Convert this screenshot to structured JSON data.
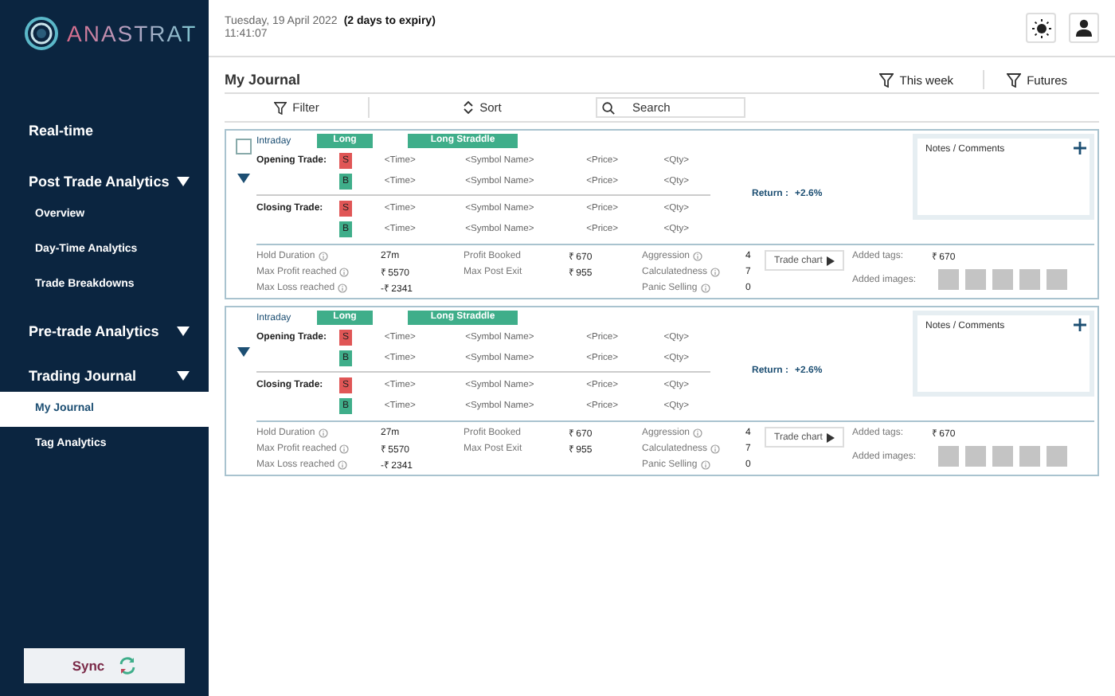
{
  "brand": {
    "name": "ANASTRAT"
  },
  "header": {
    "date": "Tuesday, 19 April 2022",
    "expiry": "(2 days to expiry)",
    "time": "11:41:07"
  },
  "sidebar": {
    "sections": [
      {
        "label": "Real-time",
        "dropdown": false
      },
      {
        "label": "Post Trade Analytics",
        "dropdown": true,
        "children": [
          {
            "label": "Overview",
            "selected": false
          },
          {
            "label": "Day-Time Analytics",
            "selected": false
          },
          {
            "label": "Trade Breakdowns",
            "selected": false
          }
        ]
      },
      {
        "label": "Pre-trade Analytics",
        "dropdown": true
      },
      {
        "label": "Trading Journal",
        "dropdown": true,
        "children": [
          {
            "label": "My Journal",
            "selected": true
          },
          {
            "label": "Tag Analytics",
            "selected": false
          }
        ]
      }
    ],
    "sync": "Sync"
  },
  "page": {
    "title": "My Journal",
    "filters": [
      "This week",
      "Futures"
    ]
  },
  "toolbar": {
    "filter": "Filter",
    "sort": "Sort",
    "search": {
      "placeholder": "Search"
    }
  },
  "cards": [
    {
      "checked": false,
      "expanded": true,
      "type": "Intraday",
      "tags": [
        "Long",
        "Long Straddle"
      ],
      "trades": [
        {
          "label": "Opening Trade:",
          "legs": [
            {
              "kind": "sell",
              "side": "S",
              "time": "<Time>",
              "symbol": "<Symbol Name>",
              "price": "<Price>",
              "qty": "<Qty>"
            },
            {
              "kind": "buy",
              "side": "B",
              "time": "<Time>",
              "symbol": "<Symbol Name>",
              "price": "<Price>",
              "qty": "<Qty>"
            }
          ]
        },
        {
          "label": "Closing Trade:",
          "legs": [
            {
              "kind": "sell",
              "side": "S",
              "time": "<Time>",
              "symbol": "<Symbol Name>",
              "price": "<Price>",
              "qty": "<Qty>"
            },
            {
              "kind": "buy",
              "side": "B",
              "time": "<Time>",
              "symbol": "<Symbol Name>",
              "price": "<Price>",
              "qty": "<Qty>"
            }
          ]
        }
      ],
      "return": {
        "label": "Return :",
        "value": "+2.6%"
      },
      "notes": "Notes / Comments",
      "stats": [
        [
          {
            "label": "Hold Duration",
            "info": true,
            "value": "27m"
          },
          {
            "label": "Max Profit reached",
            "info": true,
            "value": "₹ 5570"
          },
          {
            "label": "Max Loss reached",
            "info": true,
            "value": "-₹ 2341"
          }
        ],
        [
          {
            "label": "Profit Booked",
            "info": false,
            "value": "₹ 670"
          },
          {
            "label": "Max Post Exit",
            "info": false,
            "value": "₹ 955"
          }
        ],
        [
          {
            "label": "Aggression",
            "info": true,
            "value": "4"
          },
          {
            "label": "Calculatedness",
            "info": true,
            "value": "7"
          },
          {
            "label": "Panic Selling",
            "info": true,
            "value": "0"
          }
        ]
      ],
      "trade_chart": "Trade chart",
      "tags_label": "Added tags:",
      "tags_value": "₹ 670",
      "images_label": "Added images:",
      "images": [
        {
          "kind": "placeholder"
        },
        {
          "kind": "placeholder"
        },
        {
          "kind": "placeholder"
        },
        {
          "kind": "placeholder"
        },
        {
          "kind": "placeholder"
        }
      ]
    },
    {
      "expanded": true,
      "type": "Intraday",
      "tags": [
        "Long",
        "Long Straddle"
      ],
      "trades": [
        {
          "label": "Opening Trade:",
          "legs": [
            {
              "kind": "sell",
              "side": "S",
              "time": "<Time>",
              "symbol": "<Symbol Name>",
              "price": "<Price>",
              "qty": "<Qty>"
            },
            {
              "kind": "buy",
              "side": "B",
              "time": "<Time>",
              "symbol": "<Symbol Name>",
              "price": "<Price>",
              "qty": "<Qty>"
            }
          ]
        },
        {
          "label": "Closing Trade:",
          "legs": [
            {
              "kind": "sell",
              "side": "S",
              "time": "<Time>",
              "symbol": "<Symbol Name>",
              "price": "<Price>",
              "qty": "<Qty>"
            },
            {
              "kind": "buy",
              "side": "B",
              "time": "<Time>",
              "symbol": "<Symbol Name>",
              "price": "<Price>",
              "qty": "<Qty>"
            }
          ]
        }
      ],
      "return": {
        "label": "Return :",
        "value": "+2.6%"
      },
      "notes": "Notes / Comments",
      "stats": [
        [
          {
            "label": "Hold Duration",
            "info": true,
            "value": "27m"
          },
          {
            "label": "Max Profit reached",
            "info": true,
            "value": "₹ 5570"
          },
          {
            "label": "Max Loss reached",
            "info": true,
            "value": "-₹ 2341"
          }
        ],
        [
          {
            "label": "Profit Booked",
            "info": false,
            "value": "₹ 670"
          },
          {
            "label": "Max Post Exit",
            "info": false,
            "value": "₹ 955"
          }
        ],
        [
          {
            "label": "Aggression",
            "info": true,
            "value": "4"
          },
          {
            "label": "Calculatedness",
            "info": true,
            "value": "7"
          },
          {
            "label": "Panic Selling",
            "info": true,
            "value": "0"
          }
        ]
      ],
      "trade_chart": "Trade chart",
      "tags_label": "Added tags:",
      "tags_value": "₹ 670",
      "images_label": "Added images:",
      "images": [
        {
          "kind": "placeholder"
        },
        {
          "kind": "placeholder"
        },
        {
          "kind": "placeholder"
        },
        {
          "kind": "placeholder"
        },
        {
          "kind": "placeholder"
        }
      ]
    }
  ]
}
